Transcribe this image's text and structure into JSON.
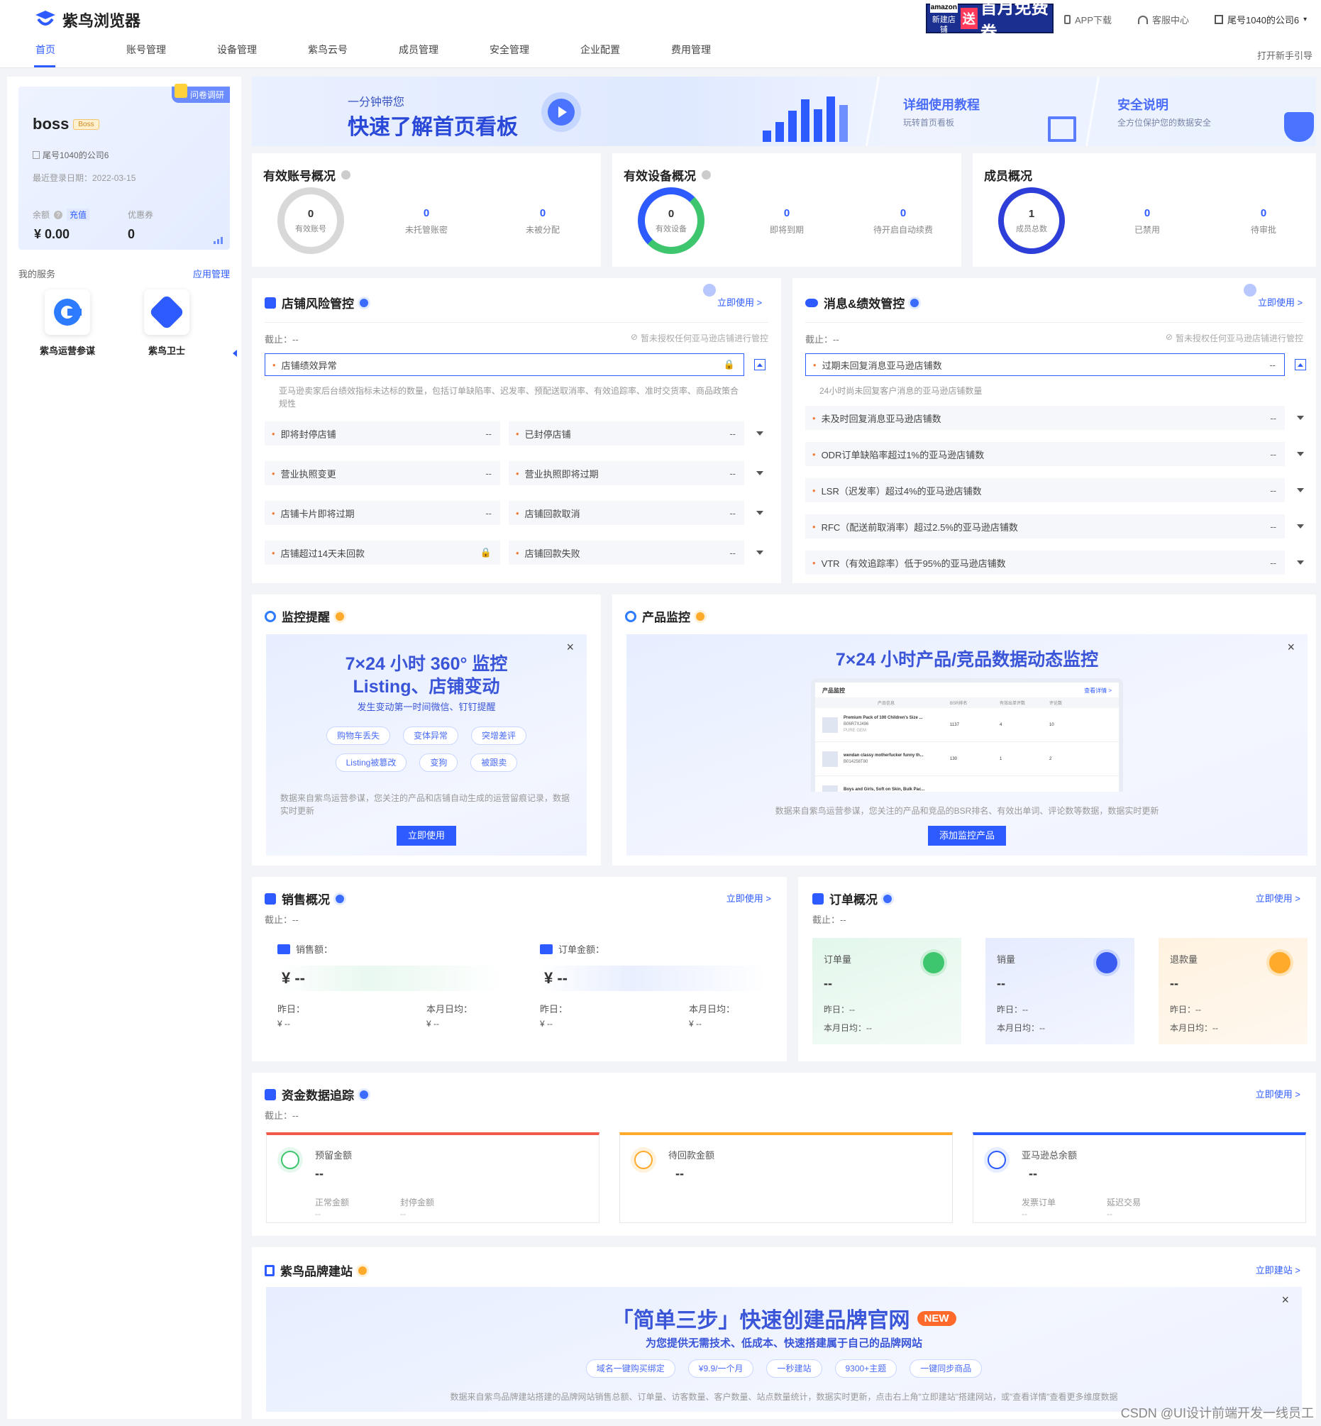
{
  "header": {
    "logo": "紫鸟浏览器",
    "nav": [
      "首页",
      "账号管理",
      "设备管理",
      "紫鸟云号",
      "成员管理",
      "安全管理",
      "企业配置",
      "费用管理"
    ],
    "ad_top": "amazon",
    "ad_bottom": "新建店铺",
    "ad_word": "送",
    "ad_big": "首月免费券",
    "app": "APP下载",
    "service": "客服中心",
    "company": "尾号1040的公司6",
    "guide": "打开新手引导"
  },
  "profile": {
    "name": "boss",
    "role": "Boss",
    "survey": "问卷调研",
    "company": "尾号1040的公司6",
    "last_login": "最近登录日期：2022-03-15",
    "balance_label": "余额",
    "recharge": "充值",
    "balance": "¥ 0.00",
    "coupon_label": "优惠券",
    "coupon": "0"
  },
  "services": {
    "title": "我的服务",
    "manage": "应用管理",
    "items": [
      "紫鸟运营参谋",
      "紫鸟卫士"
    ]
  },
  "banner": {
    "small": "一分钟带您",
    "big": "快速了解首页看板",
    "t2": "详细使用教程",
    "s2": "玩转首页看板",
    "t3": "安全说明",
    "s3": "全方位保护您的数据安全"
  },
  "accounts": {
    "title": "有效账号概况",
    "center_n": "0",
    "center_l": "有效账号",
    "stats": [
      {
        "n": "0",
        "l": "未托管账密"
      },
      {
        "n": "0",
        "l": "未被分配"
      }
    ]
  },
  "devices": {
    "title": "有效设备概况",
    "center_n": "0",
    "center_l": "有效设备",
    "stats": [
      {
        "n": "0",
        "l": "即将到期"
      },
      {
        "n": "0",
        "l": "待开启自动续费"
      }
    ]
  },
  "members": {
    "title": "成员概况",
    "center_n": "1",
    "center_l": "成员总数",
    "stats": [
      {
        "n": "0",
        "l": "已禁用"
      },
      {
        "n": "0",
        "l": "待审批"
      }
    ]
  },
  "risk": {
    "title": "店铺风险管控",
    "link": "立即使用 >",
    "deadline": "截止：--",
    "notice": "暂未授权任何亚马逊店铺进行管控",
    "main": "店铺绩效异常",
    "desc1": "亚马逊卖家后台绩效指标未达标的数量，包括订单缺陷率、迟发率、预配送取消率、有效追踪率、准时交货率、商品政策合",
    "desc2": "规性",
    "rows": [
      [
        "即将封停店铺",
        "--",
        "已封停店铺",
        "--"
      ],
      [
        "营业执照变更",
        "--",
        "营业执照即将过期",
        "--"
      ],
      [
        "店铺卡片即将过期",
        "--",
        "店铺回款取消",
        "--"
      ],
      [
        "店铺超过14天未回款",
        "",
        "店铺回款失败",
        "--"
      ]
    ]
  },
  "message": {
    "title": "消息&绩效管控",
    "link": "立即使用 >",
    "deadline": "截止：--",
    "notice": "暂未授权任何亚马逊店铺进行管控",
    "main": "过期未回复消息亚马逊店铺数",
    "main_v": "--",
    "desc": "24小时尚未回复客户消息的亚马逊店铺数量",
    "rows": [
      [
        "未及时回复消息亚马逊店铺数",
        "--"
      ],
      [
        "ODR订单缺陷率超过1%的亚马逊店铺数",
        "--"
      ],
      [
        "LSR（迟发率）超过4%的亚马逊店铺数",
        "--"
      ],
      [
        "RFC（配送前取消率）超过2.5%的亚马逊店铺数",
        "--"
      ],
      [
        "VTR（有效追踪率）低于95%的亚马逊店铺数",
        "--"
      ]
    ]
  },
  "monitor": {
    "title": "监控提醒",
    "h1": "7×24 小时 360° 监控",
    "h2": "Listing、店铺变动",
    "h3": "发生变动第一时间微信、钉钉提醒",
    "tags1": [
      "购物车丢失",
      "变体异常",
      "突增差评"
    ],
    "tags2": [
      "Listing被篡改",
      "变狗",
      "被跟卖"
    ],
    "desc1": "数据来自紫鸟运营参谋，您关注的产品和店铺自动生成的运营留痕记录，数据",
    "desc2": "实时更新",
    "btn": "立即使用"
  },
  "product": {
    "title": "产品监控",
    "h1": "7×24 小时产品/竞品数据动态监控",
    "mini_title": "产品监控",
    "mini_link": "查看详情 >",
    "cols": [
      "产品信息",
      "BSR排名",
      "有效出单评数",
      "评论数"
    ],
    "items": [
      {
        "name": "Premium Pack of 100 Children's Size ...",
        "id": "B06R7XJ496",
        "brand": "PURE GEM",
        "bsr": "1137",
        "a": "4",
        "b": "10"
      },
      {
        "name": "wendan classy motherfucker funny th...",
        "id": "B014258T80",
        "brand": "",
        "bsr": "130",
        "a": "1",
        "b": "2"
      },
      {
        "name": "Boys and Girls, Soft on Skin, Bulk Pac...",
        "id": "",
        "brand": "",
        "bsr": "",
        "a": "",
        "b": ""
      }
    ],
    "desc": "数据来自紫鸟运营参谋，您关注的产品和竞品的BSR排名、有效出单词、评论数等数据，数据实时更新",
    "btn": "添加监控产品"
  },
  "sales": {
    "title": "销售概况",
    "link": "立即使用 >",
    "deadline": "截止：--",
    "a_label": "销售额：",
    "a_val": "¥ --",
    "b_label": "订单金额：",
    "b_val": "¥ --",
    "y": "昨日：",
    "m": "本月日均：",
    "v": "¥ --"
  },
  "orders": {
    "title": "订单概况",
    "link": "立即使用 >",
    "deadline": "截止：--",
    "cards": [
      {
        "l": "订单量",
        "v": "--"
      },
      {
        "l": "销量",
        "v": "--"
      },
      {
        "l": "退款量",
        "v": "--"
      }
    ],
    "y": "昨日：--",
    "m": "本月日均：--"
  },
  "funds": {
    "title": "资金数据追踪",
    "link": "立即使用 >",
    "deadline": "截止：--",
    "cards": [
      {
        "l": "预留金额",
        "v": "--",
        "s1": "正常金额",
        "s2": "封停金额",
        "sv": "--"
      },
      {
        "l": "待回款金额",
        "v": "--",
        "s1": "",
        "s2": "",
        "sv": ""
      },
      {
        "l": "亚马逊总余额",
        "v": "--",
        "s1": "发票订单",
        "s2": "延迟交易",
        "sv": "--"
      }
    ]
  },
  "brand": {
    "title": "紫鸟品牌建站",
    "link": "立即建站 >",
    "h1": "「简单三步」快速创建品牌官网",
    "new": "NEW",
    "h2": "为您提供无需技术、低成本、快速搭建属于自己的品牌网站",
    "tags": [
      "域名一键购买绑定",
      "¥9.9/一个月",
      "一秒建站",
      "9300+主题",
      "一键同步商品"
    ],
    "desc": "数据来自紫鸟品牌建站搭建的品牌网站销售总额、订单量、访客数量、客户数量、站点数量统计，数据实时更新，点击右上角\"立即建站\"搭建网站，或\"查看详情\"查看更多维度数据"
  },
  "watermark": "CSDN @UI设计前端开发一线员工",
  "colors": {
    "accent": "#2d5bff",
    "green": "#3ec66e",
    "orange": "#ffaa2b",
    "red": "#f05a4b"
  }
}
